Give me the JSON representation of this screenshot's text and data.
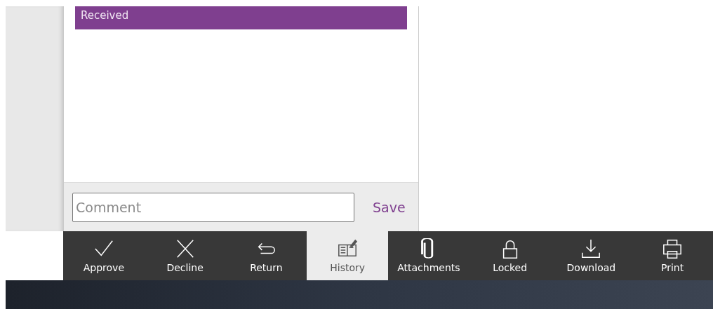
{
  "list": {
    "items": [
      {
        "label": "Received",
        "selected": true
      }
    ]
  },
  "comment": {
    "placeholder": "Comment",
    "save": "Save"
  },
  "toolbar": [
    {
      "kind": "approve",
      "label": "Approve",
      "selected": false
    },
    {
      "kind": "decline",
      "label": "Decline",
      "selected": false
    },
    {
      "kind": "return",
      "label": "Return",
      "selected": false
    },
    {
      "kind": "history",
      "label": "History",
      "selected": true
    },
    {
      "kind": "attach",
      "label": "Attachments",
      "selected": false
    },
    {
      "kind": "lock",
      "label": "Locked",
      "selected": false
    },
    {
      "kind": "download",
      "label": "Download",
      "selected": false
    },
    {
      "kind": "print",
      "label": "Print",
      "selected": false
    }
  ]
}
